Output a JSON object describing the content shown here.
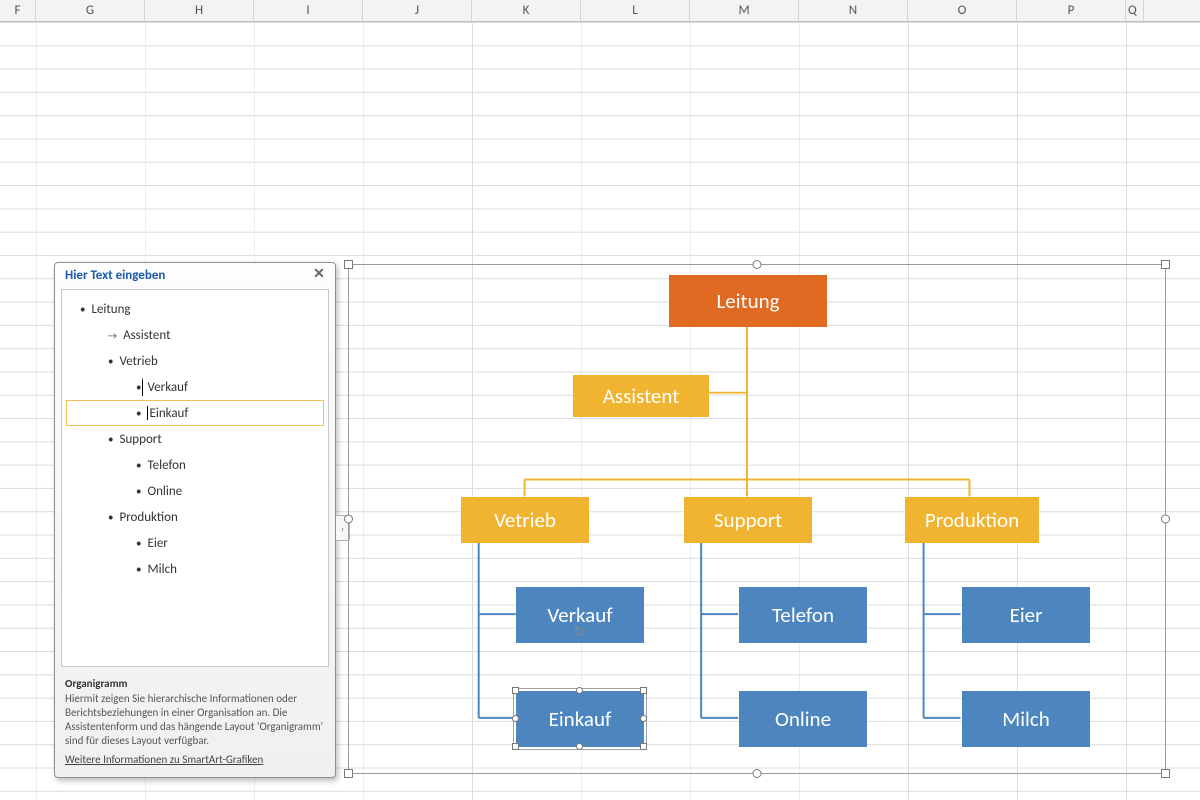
{
  "columns": [
    "F",
    "G",
    "H",
    "I",
    "J",
    "K",
    "L",
    "M",
    "N",
    "O",
    "P",
    "Q"
  ],
  "textPane": {
    "title": "Hier Text eingeben",
    "items": [
      {
        "level": 1,
        "type": "bullet",
        "label": "Leitung"
      },
      {
        "level": 2,
        "type": "arrow",
        "label": "Assistent"
      },
      {
        "level": 2,
        "type": "bullet",
        "label": "Vetrieb"
      },
      {
        "level": 3,
        "type": "bullet",
        "label": "Verkauf",
        "editing": true
      },
      {
        "level": 3,
        "type": "bullet",
        "label": "Einkauf",
        "selected": true,
        "caret": true
      },
      {
        "level": 2,
        "type": "bullet",
        "label": "Support"
      },
      {
        "level": 3,
        "type": "bullet",
        "label": "Telefon"
      },
      {
        "level": 3,
        "type": "bullet",
        "label": "Online"
      },
      {
        "level": 2,
        "type": "bullet",
        "label": "Produktion"
      },
      {
        "level": 3,
        "type": "bullet",
        "label": "Eier"
      },
      {
        "level": 3,
        "type": "bullet",
        "label": "Milch"
      }
    ],
    "desc": {
      "title": "Organigramm",
      "body": "Hiermit zeigen Sie hierarchische Informationen oder Berichtsbeziehungen in einer Organisation an. Die Assistentenform und das hängende Layout 'Organigramm' sind für dieses Layout verfügbar.",
      "link": "Weitere Informationen zu SmartArt-Grafiken"
    }
  },
  "chart": {
    "nodes": {
      "leitung": {
        "label": "Leitung",
        "color": "orange"
      },
      "assistent": {
        "label": "Assistent",
        "color": "yellow"
      },
      "vetrieb": {
        "label": "Vetrieb",
        "color": "yellow"
      },
      "support": {
        "label": "Support",
        "color": "yellow"
      },
      "produktion": {
        "label": "Produktion",
        "color": "yellow"
      },
      "verkauf": {
        "label": "Verkauf",
        "color": "blue"
      },
      "einkauf": {
        "label": "Einkauf",
        "color": "blue",
        "selected": true
      },
      "telefon": {
        "label": "Telefon",
        "color": "blue"
      },
      "online": {
        "label": "Online",
        "color": "blue"
      },
      "eier": {
        "label": "Eier",
        "color": "blue"
      },
      "milch": {
        "label": "Milch",
        "color": "blue"
      }
    }
  },
  "expandTab": "›"
}
